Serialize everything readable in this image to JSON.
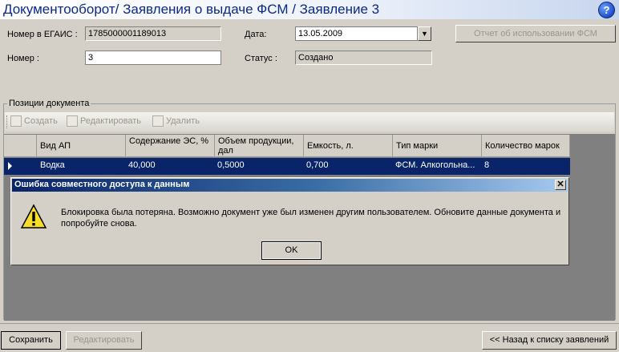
{
  "header": {
    "title": "Документооборот/ Заявления о выдаче ФСМ / Заявление 3",
    "help_label": "?"
  },
  "form": {
    "egais_label": "Номер в ЕГАИС :",
    "egais_value": "1785000001189013",
    "number_label": "Номер :",
    "number_value": "3",
    "date_label": "Дата:",
    "date_value": "13.05.2009",
    "status_label": "Статус :",
    "status_value": "Создано",
    "report_button": "Отчет об использовании ФСМ"
  },
  "positions": {
    "group_label": "Позиции документа",
    "toolbar": {
      "create": "Создать",
      "edit": "Редактировать",
      "delete": "Удалить"
    },
    "columns": [
      "Вид АП",
      "Содержание ЭС, %",
      "Объем продукции, дал",
      "Емкость, л.",
      "Тип марки",
      "Количество марок"
    ],
    "rows": [
      [
        "Водка",
        "40,000",
        "0,5000",
        "0,700",
        "ФСМ. Алкогольна...",
        "8"
      ]
    ]
  },
  "dialog": {
    "title": "Ошибка совместного доступа к данным",
    "close_label": "✕",
    "message": "Блокировка была потеряна. Возможно документ уже был изменен другим пользователем. Обновите данные документа и попробуйте снова.",
    "ok_label": "OK"
  },
  "footer": {
    "save_label": "Сохранить",
    "edit_label": "Редактировать",
    "back_label": "<< Назад к списку заявлений"
  },
  "colors": {
    "header_text": "#0b2a86",
    "selection": "#0a246a",
    "dialog_title": "#0a246a"
  }
}
